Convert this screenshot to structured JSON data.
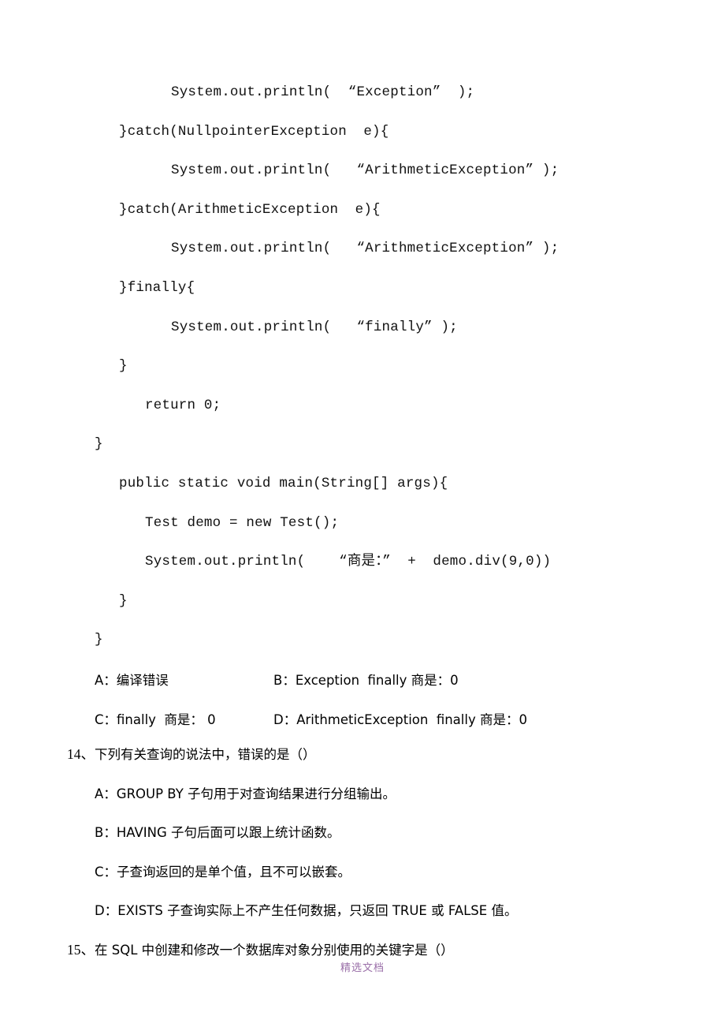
{
  "document": {
    "type": "exam-paper-page",
    "language": "zh-CN",
    "background_color": "#ffffff",
    "text_color": "#000000"
  },
  "code_block": {
    "lines": [
      {
        "indent": 3,
        "text": "System.out.println(  “Exception”  );"
      },
      {
        "indent": 1,
        "text": "}catch(NullpointerException  e){"
      },
      {
        "indent": 3,
        "text": "System.out.println(   “ArithmeticException” );"
      },
      {
        "indent": 1,
        "text": "}catch(ArithmeticException  e){"
      },
      {
        "indent": 3,
        "text": "System.out.println(   “ArithmeticException” );"
      },
      {
        "indent": 1,
        "text": "}finally{"
      },
      {
        "indent": 3,
        "text": "System.out.println(   “finally” );"
      },
      {
        "indent": 1,
        "text": "}"
      },
      {
        "indent": 2,
        "text": "return 0;"
      },
      {
        "indent": 0,
        "text": "}"
      },
      {
        "indent": 1,
        "text": "public static void main(String[] args){"
      },
      {
        "indent": 2,
        "text": "Test demo = new Test();"
      },
      {
        "indent": 2,
        "text": "System.out.println(    “商是：”  +  demo.div(9,0))"
      },
      {
        "indent": 1,
        "text": "}"
      },
      {
        "indent": 0,
        "text": "}"
      }
    ]
  },
  "question_13_answers": {
    "rows": [
      {
        "left": "A：编译错误",
        "right": "B：Exception  finally 商是：0"
      },
      {
        "left": "C：finally  商是： 0",
        "right": "D：ArithmeticException  finally 商是：0"
      }
    ]
  },
  "question_14": {
    "stem_number": "14、",
    "stem_text": "下列有关查询的说法中，错误的是（）",
    "options": [
      "A：GROUP BY 子句用于对查询结果进行分组输出。",
      "B：HAVING 子句后面可以跟上统计函数。",
      "C：子查询返回的是单个值，且不可以嵌套。",
      "D：EXISTS 子查询实际上不产生任何数据，只返回 TRUE 或 FALSE 值。"
    ]
  },
  "question_15": {
    "stem_number": "15、",
    "stem_text": "在 SQL 中创建和修改一个数据库对象分别使用的关键字是（）"
  },
  "watermark": {
    "text": "精选文档",
    "color": "#9a6fa8"
  }
}
